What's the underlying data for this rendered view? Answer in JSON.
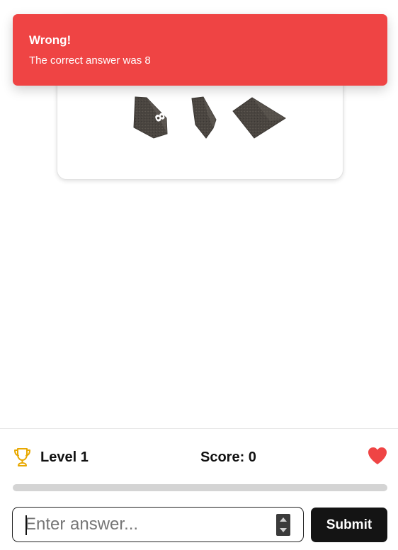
{
  "toast": {
    "title": "Wrong!",
    "message": "The correct answer was 8",
    "color": "#ef4444"
  },
  "dice": {
    "faces_visible": [
      "8",
      "",
      ""
    ],
    "die_color": "#4a4540"
  },
  "status": {
    "level_label": "Level 1",
    "score_label": "Score: 0",
    "trophy_icon": "trophy-icon",
    "heart_icon": "heart-icon",
    "heart_color": "#ef4444",
    "trophy_color": "#e8a800"
  },
  "progress": {
    "fraction": 0.0
  },
  "answer": {
    "value": "",
    "placeholder": "Enter answer...",
    "submit_label": "Submit"
  }
}
